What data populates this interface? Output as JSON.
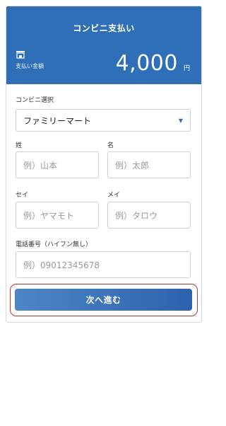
{
  "header": {
    "title": "コンビニ支払い",
    "amount_label": "支払い金額",
    "amount_value": "4,000",
    "amount_unit": "円"
  },
  "form": {
    "store_label": "コンビニ選択",
    "store_selected": "ファミリーマート",
    "last_name_label": "姓",
    "last_name_placeholder": "例）山本",
    "first_name_label": "名",
    "first_name_placeholder": "例）太郎",
    "last_kana_label": "セイ",
    "last_kana_placeholder": "例）ヤマモト",
    "first_kana_label": "メイ",
    "first_kana_placeholder": "例）タロウ",
    "phone_label": "電話番号（ハイフン無し）",
    "phone_placeholder": "例）09012345678",
    "next_button_label": "次へ進む"
  },
  "colors": {
    "brand": "#2f6fb8",
    "highlight_border": "#b23b30"
  },
  "icons": {
    "store": "store-icon",
    "dropdown": "chevron-down-icon"
  }
}
